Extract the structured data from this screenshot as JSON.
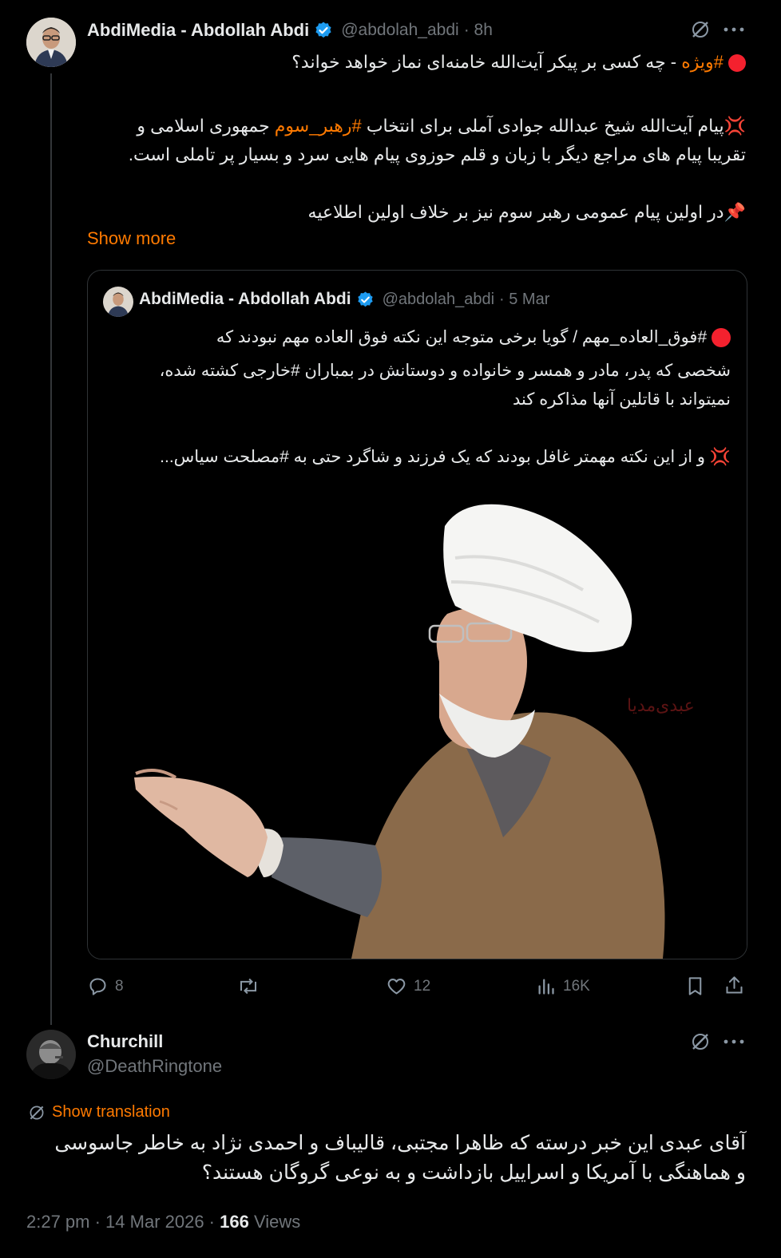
{
  "tweet": {
    "author_name": "AbdiMedia - Abdollah Abdi",
    "handle": "@abdolah_abdi",
    "time": "· 8h",
    "line1_tag": "#ویژه",
    "line1_rest": " - چه کسی بر پیکر آیت‌الله خامنه‌ای نماز خواهد خواند؟",
    "p2_a": "پیام آیت‌الله شیخ عبدالله جوادی آملی برای انتخاب ",
    "p2_tag": "#رهبر_سوم",
    "p2_b": " جمهوری اسلامی و",
    "p2_line2": "تقریبا پیام های مراجع دیگر با زبان و قلم حوزوی پیام هایی سرد و بسیار پر تاملی است.",
    "p3": "در اولین پیام عمومی رهبر سوم نیز بر خلاف اولین اطلاعیه",
    "show_more": "Show more",
    "emoji_anger": "💢",
    "emoji_pin": "📌",
    "actions": {
      "replies": "8",
      "likes": "12",
      "views": "16K"
    }
  },
  "quote": {
    "author_name": "AbdiMedia - Abdollah Abdi",
    "handle": "@abdolah_abdi",
    "date": "· 5 Mar",
    "line1": "#فوق_العاده_مهم / گویا برخی متوجه این نکته فوق العاده مهم نبودند که",
    "line2": "شخصی که پدر، مادر و همسر و خانواده و دوستانش در بمباران #خارجی کشته شده،",
    "line3": "نمیتواند با قاتلین آنها مذاکره کند",
    "line4": "و از این نکته مهمتر غافل بودند که یک فرزند و شاگرد حتی به #مصلحت سیاس...",
    "watermark": "عبدی‌مدیا"
  },
  "reply": {
    "author_name": "Churchill",
    "handle": "@DeathRingtone",
    "show_translation": "Show translation",
    "line1": "آقای عبدی این خبر درسته که ظاهرا مجتبی، قالیباف  و احمدی نژاد به خاطر جاسوسی",
    "line2": "و هماهنگی با آمریکا و اسراییل بازداشت و به نوعی گروگان هستند؟",
    "timestamp": "2:27 pm · 14 Mar 2026 · ",
    "views_count": "166",
    "views_label": " Views"
  },
  "colors": {
    "accent": "#ff7a00",
    "verified": "#1d9bf0",
    "background": "#000000",
    "muted": "#71767b"
  },
  "icons": [
    "verified-badge-icon",
    "grok-icon",
    "more-icon",
    "reply-icon",
    "retweet-icon",
    "like-icon",
    "views-icon",
    "bookmark-icon",
    "share-icon",
    "translate-icon"
  ]
}
